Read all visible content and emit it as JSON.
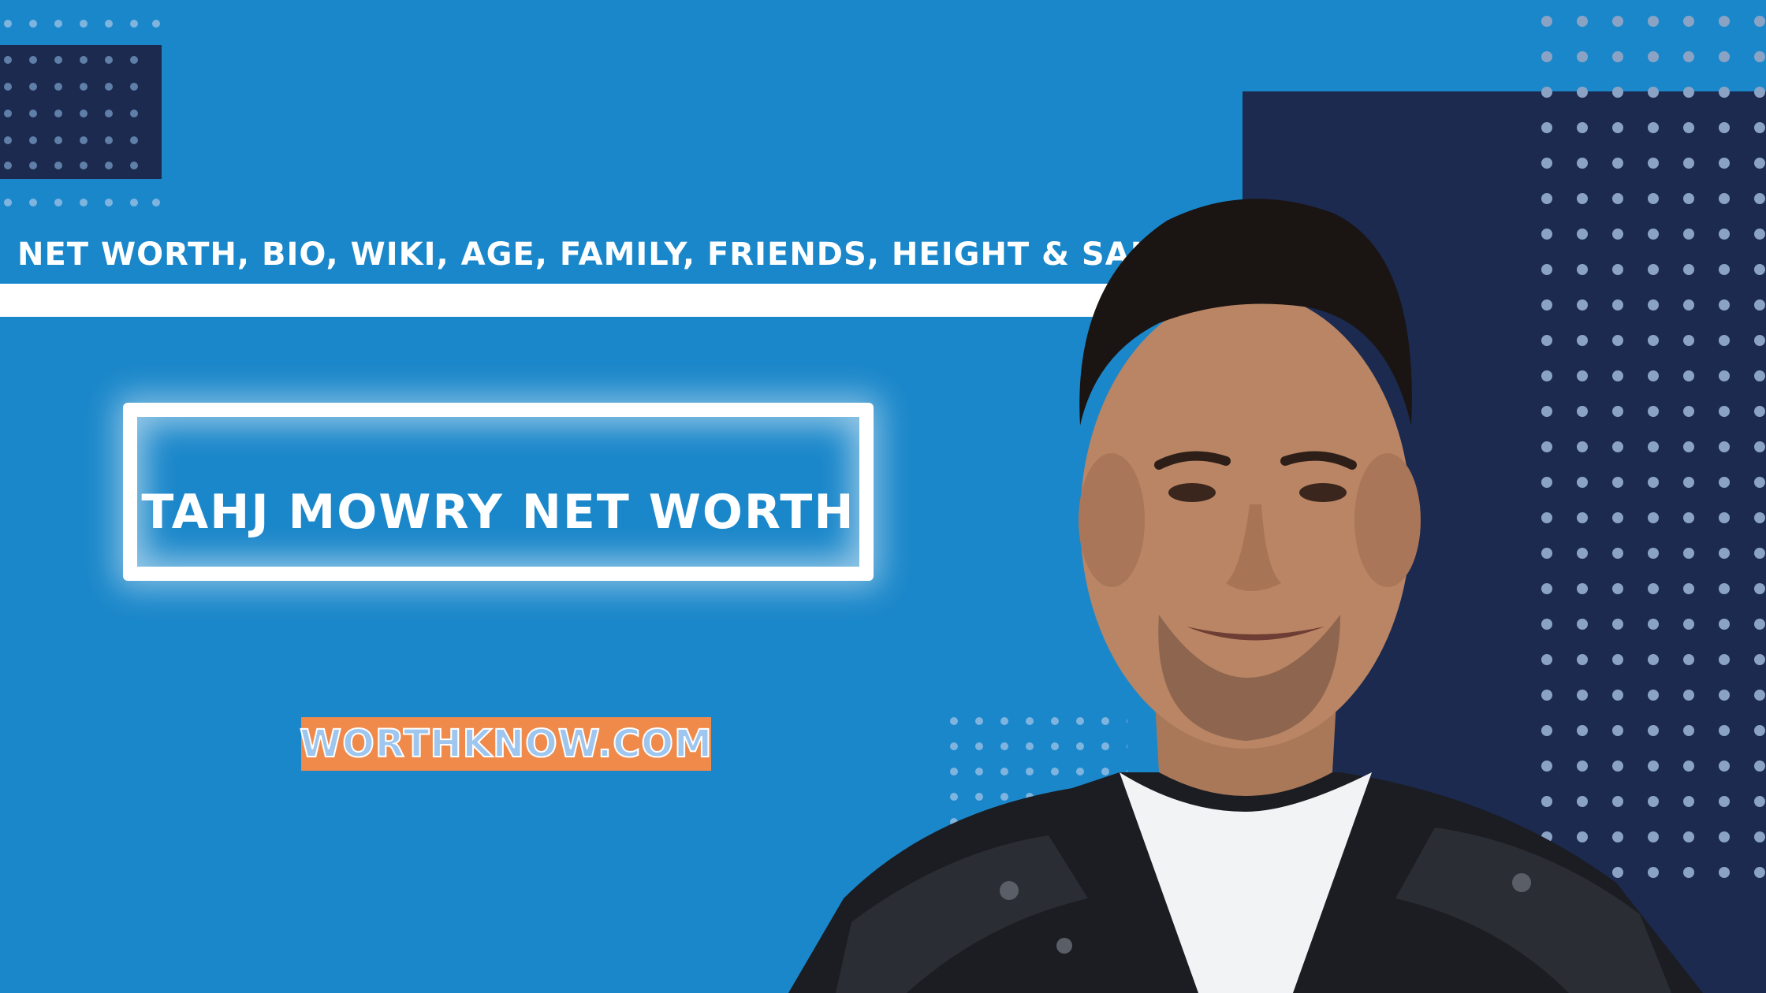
{
  "banner": {
    "subtitle": "NET WORTH, BIO, WIKI, AGE, FAMILY, FRIENDS, HEIGHT & SALARY",
    "title": "TAHJ MOWRY NET WORTH",
    "brand": "WORTHKNOW.COM"
  },
  "colors": {
    "background": "#1a87ca",
    "dark_navy": "#1c2a4f",
    "brand_badge": "#f08a4b",
    "text": "#ffffff"
  },
  "image": {
    "subject": "portrait-of-man-in-leather-jacket"
  }
}
